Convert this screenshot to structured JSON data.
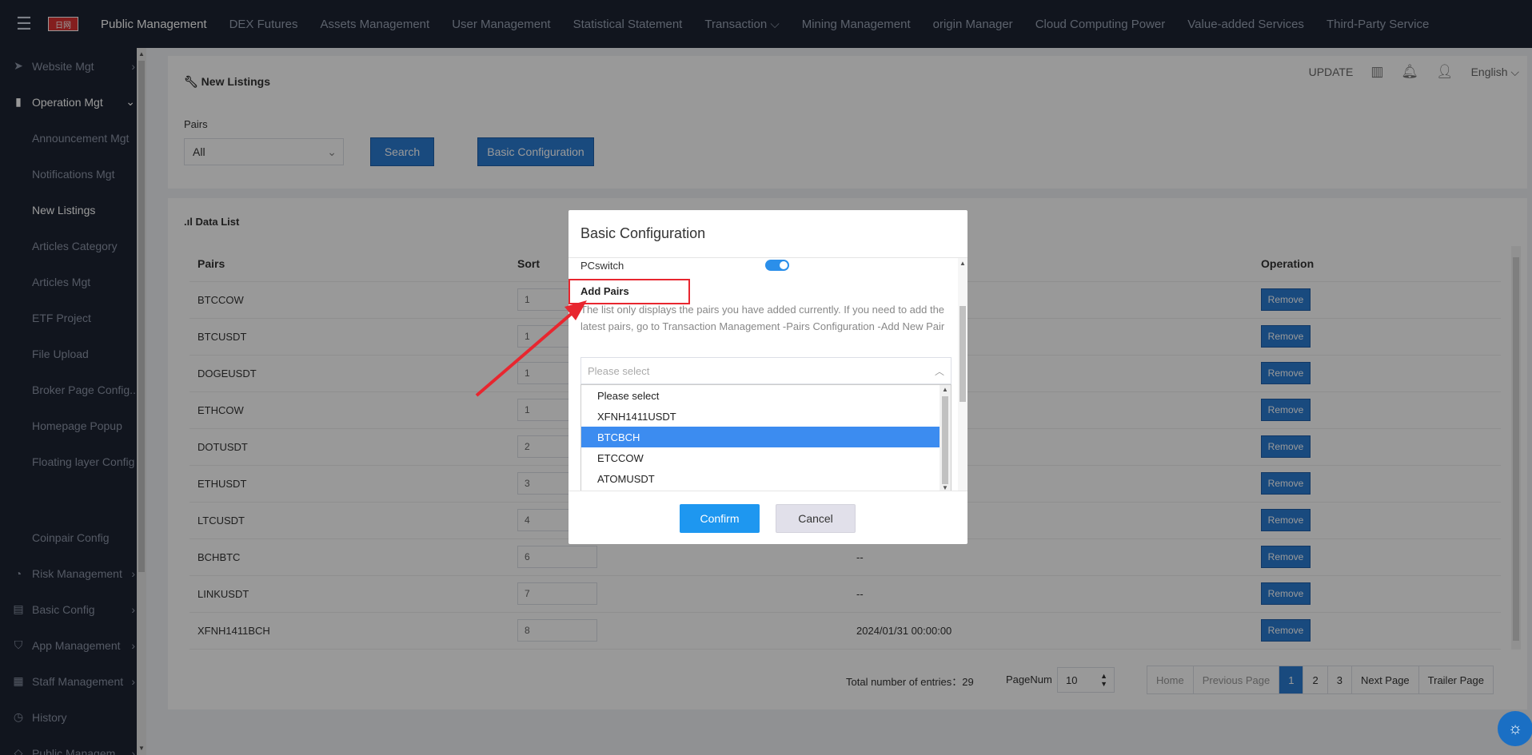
{
  "topbar": {
    "logo_text": "日网",
    "nav": [
      {
        "label": "Public Management",
        "active": true
      },
      {
        "label": "DEX Futures"
      },
      {
        "label": "Assets Management"
      },
      {
        "label": "User Management"
      },
      {
        "label": "Statistical Statement"
      },
      {
        "label": "Transaction ⌵"
      },
      {
        "label": "Mining Management"
      },
      {
        "label": "origin Manager"
      },
      {
        "label": "Cloud Computing Power"
      },
      {
        "label": "Value-added Services"
      },
      {
        "label": "Third-Party Service"
      }
    ]
  },
  "sidebar": {
    "items": [
      {
        "type": "group",
        "icon": "➤",
        "icon_name": "send-icon",
        "label": "Website Mgt",
        "arrow": "›"
      },
      {
        "type": "group",
        "icon": "▮",
        "icon_name": "bar-chart-icon",
        "label": "Operation Mgt",
        "arrow": "⌄",
        "open": true
      },
      {
        "type": "sub",
        "label": "Announcement Mgt"
      },
      {
        "type": "sub",
        "label": "Notifications Mgt"
      },
      {
        "type": "sub",
        "label": "New Listings",
        "active": true
      },
      {
        "type": "sub",
        "label": "Articles Category"
      },
      {
        "type": "sub",
        "label": "Articles Mgt"
      },
      {
        "type": "sub",
        "label": "ETF Project"
      },
      {
        "type": "sub",
        "label": "File Upload"
      },
      {
        "type": "sub",
        "label": "Broker Page Config..."
      },
      {
        "type": "sub",
        "label": "Homepage Popup"
      },
      {
        "type": "sub",
        "label": "Floating layer Config"
      },
      {
        "type": "spacer"
      },
      {
        "type": "sub",
        "label": "Coinpair Config"
      },
      {
        "type": "group",
        "icon": "◔",
        "icon_name": "risk-icon",
        "label": "Risk Management",
        "arrow": "›"
      },
      {
        "type": "group",
        "icon": "▤",
        "icon_name": "config-icon",
        "label": "Basic Config",
        "arrow": "›"
      },
      {
        "type": "group",
        "icon": "⛉",
        "icon_name": "cart-icon",
        "label": "App Management",
        "arrow": "›"
      },
      {
        "type": "group",
        "icon": "▦",
        "icon_name": "staff-icon",
        "label": "Staff Management",
        "arrow": "›"
      },
      {
        "type": "group",
        "icon": "◷",
        "icon_name": "history-icon",
        "label": "History",
        "arrow": ""
      },
      {
        "type": "group",
        "icon": "◇",
        "icon_name": "diamond-icon",
        "label": "Public Managem...",
        "arrow": "›"
      }
    ]
  },
  "header_tools": {
    "update": "UPDATE",
    "language": "English ⌵"
  },
  "search_panel": {
    "title": "New Listings",
    "pairs_label": "Pairs",
    "pairs_value": "All",
    "search_button": "Search",
    "basic_config_button": "Basic Configuration"
  },
  "data_list": {
    "title": "Data List",
    "columns": {
      "pairs": "Pairs",
      "sort": "Sort",
      "operation": "Operation"
    },
    "rows": [
      {
        "pair": "BTCCOW",
        "sort": "1",
        "time": "",
        "action": "Remove"
      },
      {
        "pair": "BTCUSDT",
        "sort": "1",
        "time": "",
        "action": "Remove"
      },
      {
        "pair": "DOGEUSDT",
        "sort": "1",
        "time": "",
        "action": "Remove"
      },
      {
        "pair": "ETHCOW",
        "sort": "1",
        "time": "",
        "action": "Remove"
      },
      {
        "pair": "DOTUSDT",
        "sort": "2",
        "time": "",
        "action": "Remove"
      },
      {
        "pair": "ETHUSDT",
        "sort": "3",
        "time": "",
        "action": "Remove"
      },
      {
        "pair": "LTCUSDT",
        "sort": "4",
        "time": "",
        "action": "Remove"
      },
      {
        "pair": "BCHBTC",
        "sort": "6",
        "time": "--",
        "action": "Remove"
      },
      {
        "pair": "LINKUSDT",
        "sort": "7",
        "time": "--",
        "action": "Remove"
      },
      {
        "pair": "XFNH1411BCH",
        "sort": "8",
        "time": "2024/01/31 00:00:00",
        "action": "Remove"
      }
    ]
  },
  "pagination": {
    "total": "Total number of entries：29",
    "pagenum_label": "PageNum",
    "page_size": "10",
    "home": "Home",
    "previous": "Previous Page",
    "pages": [
      "1",
      "2",
      "3"
    ],
    "current": "1",
    "next": "Next Page",
    "trailer": "Trailer Page"
  },
  "modal": {
    "title": "Basic Configuration",
    "pc_switch_label": "PCswitch",
    "pc_switch_on": true,
    "add_pairs_label": "Add Pairs",
    "hint": "The list only displays the pairs you have added currently. If you need to add the latest pairs, go to Transaction Management -Pairs Configuration -Add New Pair",
    "select_placeholder": "Please select",
    "options": [
      {
        "label": "Please select"
      },
      {
        "label": "XFNH1411USDT"
      },
      {
        "label": "BTCBCH",
        "selected": true
      },
      {
        "label": "ETCCOW"
      },
      {
        "label": "ATOMUSDT"
      }
    ],
    "confirm": "Confirm",
    "cancel": "Cancel"
  },
  "colors": {
    "topbar_bg": "#1d2433",
    "primary_blue": "#2b7cd3",
    "confirm_blue": "#1e97f0",
    "highlight_red": "#e8262f",
    "option_selected": "#3c8cf0"
  }
}
